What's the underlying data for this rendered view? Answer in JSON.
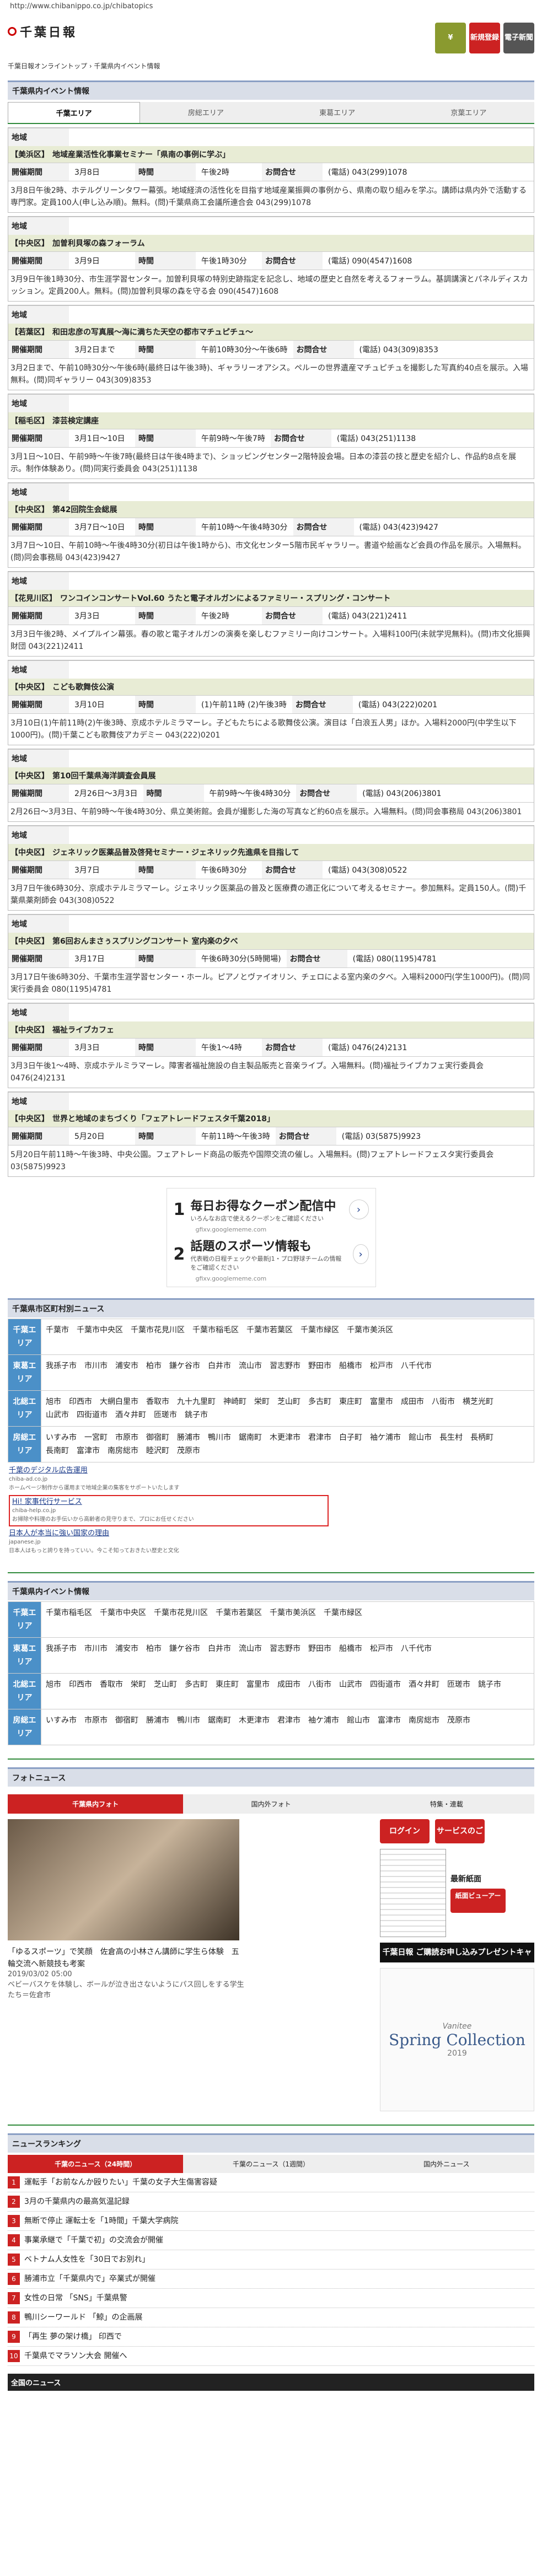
{
  "url": "http://www.chibanippo.co.jp/chibatopics",
  "logo_text": "千葉日報",
  "header_buttons": [
    "新規登録",
    "電子新聞"
  ],
  "breadcrumb": "千葉日報オンライントップ › 千葉県内イベント情報",
  "event_section_title": "千葉県内イベント情報",
  "tabs": [
    "千葉エリア",
    "房総エリア",
    "東葛エリア",
    "京葉エリア"
  ],
  "labels": {
    "period": "開催期間",
    "time": "時間",
    "contact": "お問合せ",
    "area": "地域"
  },
  "events": [
    {
      "area": "【美浜区】",
      "title": "地域産業活性化事業セミナー「県南の事例に学ぶ」",
      "period": "3月8日",
      "time": "午後2時",
      "contact": "(電話) 043(299)1078",
      "desc": "3月8日午後2時、ホテルグリーンタワー幕張。地域経済の活性化を目指す地域産業振興の事例から、県南の取り組みを学ぶ。講師は県内外で活動する専門家。定員100人(申し込み順)。無料。(問)千葉県商工会議所連合会 043(299)1078"
    },
    {
      "area": "【中央区】",
      "title": "加曽利貝塚の森フォーラム",
      "period": "3月9日",
      "time": "午後1時30分",
      "contact": "(電話) 090(4547)1608",
      "desc": "3月9日午後1時30分、市生涯学習センター。加曽利貝塚の特別史跡指定を記念し、地域の歴史と自然を考えるフォーラム。基調講演とパネルディスカッション。定員200人。無料。(問)加曽利貝塚の森を守る会 090(4547)1608"
    },
    {
      "area": "【若葉区】",
      "title": "和田忠彦の写真展〜海に満ちた天空の都市マチュピチュ〜",
      "period": "3月2日まで",
      "time": "午前10時30分〜午後6時",
      "contact": "(電話) 043(309)8353",
      "desc": "3月2日まで、午前10時30分〜午後6時(最終日は午後3時)、ギャラリーオアシス。ペルーの世界遺産マチュピチュを撮影した写真約40点を展示。入場無料。(問)同ギャラリー 043(309)8353"
    },
    {
      "area": "【稲毛区】",
      "title": "漆芸検定講座",
      "period": "3月1日〜10日",
      "time": "午前9時〜午後7時",
      "contact": "(電話) 043(251)1138",
      "desc": "3月1日〜10日、午前9時〜午後7時(最終日は午後4時まで)、ショッピングセンター2階特設会場。日本の漆芸の技と歴史を紹介し、作品約8点を展示。制作体験あり。(問)同実行委員会 043(251)1138"
    },
    {
      "area": "【中央区】",
      "title": "第42回院生会総展",
      "period": "3月7日〜10日",
      "time": "午前10時〜午後4時30分",
      "contact": "(電話) 043(423)9427",
      "desc": "3月7日〜10日、午前10時〜午後4時30分(初日は午後1時から)、市文化センター5階市民ギャラリー。書道や絵画など会員の作品を展示。入場無料。(問)同会事務局 043(423)9427"
    },
    {
      "area": "【花見川区】",
      "title": "ワンコインコンサートVol.60 うたと電子オルガンによるファミリー・スプリング・コンサート",
      "period": "3月3日",
      "time": "午後2時",
      "contact": "(電話) 043(221)2411",
      "desc": "3月3日午後2時、メイプルイン幕張。春の歌と電子オルガンの演奏を楽しむファミリー向けコンサート。入場料100円(未就学児無料)。(問)市文化振興財団 043(221)2411"
    },
    {
      "area": "【中央区】",
      "title": "こども歌舞伎公演",
      "period": "3月10日",
      "time": "(1)午前11時 (2)午後3時",
      "contact": "(電話) 043(222)0201",
      "desc": "3月10日(1)午前11時(2)午後3時、京成ホテルミラマーレ。子どもたちによる歌舞伎公演。演目は「白浪五人男」ほか。入場料2000円(中学生以下1000円)。(問)千葉こども歌舞伎アカデミー 043(222)0201"
    },
    {
      "area": "【中央区】",
      "title": "第10回千葉県海洋調査会員展",
      "period": "2月26日〜3月3日",
      "time": "午前9時〜午後4時30分",
      "contact": "(電話) 043(206)3801",
      "desc": "2月26日〜3月3日、午前9時〜午後4時30分、県立美術館。会員が撮影した海の写真など約60点を展示。入場無料。(問)同会事務局 043(206)3801"
    },
    {
      "area": "【中央区】",
      "title": "ジェネリック医薬品普及啓発セミナー・ジェネリック先進県を目指して",
      "period": "3月7日",
      "time": "午後6時30分",
      "contact": "(電話) 043(308)0522",
      "desc": "3月7日午後6時30分、京成ホテルミラマーレ。ジェネリック医薬品の普及と医療費の適正化について考えるセミナー。参加無料。定員150人。(問)千葉県薬剤師会 043(308)0522"
    },
    {
      "area": "【中央区】",
      "title": "第6回おんまさぅスプリングコンサート 室内楽の夕べ",
      "period": "3月17日",
      "time": "午後6時30分(5時開場)",
      "contact": "(電話) 080(1195)4781",
      "desc": "3月17日午後6時30分、千葉市生涯学習センター・ホール。ピアノとヴァイオリン、チェロによる室内楽の夕べ。入場料2000円(学生1000円)。(問)同実行委員会 080(1195)4781"
    },
    {
      "area": "【中央区】",
      "title": "福祉ライブカフェ",
      "period": "3月3日",
      "time": "午後1〜4時",
      "contact": "(電話) 0476(24)2131",
      "desc": "3月3日午後1〜4時、京成ホテルミラマーレ。障害者福祉施設の自主製品販売と音楽ライブ。入場無料。(問)福祉ライブカフェ実行委員会 0476(24)2131"
    },
    {
      "area": "【中央区】",
      "title": "世界と地域のまちづくり「フェアトレードフェスタ千葉2018」",
      "period": "5月20日",
      "time": "午前11時〜午後3時",
      "contact": "(電話) 03(5875)9923",
      "desc": "5月20日午前11時〜午後3時、中央公園。フェアトレード商品の販売や国際交流の催し。入場無料。(問)フェアトレードフェスタ実行委員会 03(5875)9923"
    }
  ],
  "ads": [
    {
      "num": "1",
      "title": "毎日お得なクーポン配信中",
      "sub": "いろんなお店で使えるクーポンをご確認ください",
      "src": "gfixv.googlememe.com"
    },
    {
      "num": "2",
      "title": "話題のスポーツ情報も",
      "sub": "代表戦の日程チェックや最新J1・プロ野球チームの情報をご確認ください",
      "src": "gfixv.googlememe.com"
    }
  ],
  "cities_section_title": "千葉県市区町村別ニュース",
  "regions_news": [
    {
      "label": "千葉エリア",
      "cities": [
        "千葉市",
        "千葉市中央区",
        "千葉市花見川区",
        "千葉市稲毛区",
        "千葉市若葉区",
        "千葉市緑区",
        "千葉市美浜区"
      ]
    },
    {
      "label": "東葛エリア",
      "cities": [
        "我孫子市",
        "市川市",
        "浦安市",
        "柏市",
        "鎌ケ谷市",
        "白井市",
        "流山市",
        "習志野市",
        "野田市",
        "船橋市",
        "松戸市",
        "八千代市"
      ]
    },
    {
      "label": "北総エリア",
      "cities": [
        "旭市",
        "印西市",
        "大網白里市",
        "香取市",
        "九十九里町",
        "神崎町",
        "栄町",
        "芝山町",
        "多古町",
        "東庄町",
        "富里市",
        "成田市",
        "八街市",
        "横芝光町",
        "山武市",
        "四街道市",
        "酒々井町",
        "匝瑳市",
        "銚子市"
      ]
    },
    {
      "label": "房総エリア",
      "cities": [
        "いすみ市",
        "一宮町",
        "市原市",
        "御宿町",
        "勝浦市",
        "鴨川市",
        "鋸南町",
        "木更津市",
        "君津市",
        "白子町",
        "袖ケ浦市",
        "館山市",
        "長生村",
        "長柄町",
        "長南町",
        "富津市",
        "南房総市",
        "睦沢町",
        "茂原市"
      ]
    }
  ],
  "text_ads": [
    {
      "title": "千葉のデジタル広告運用",
      "url": "chiba-ad.co.jp",
      "desc": "ホームページ制作から運用まで地域企業の集客をサポートいたします"
    },
    {
      "title": "Hi! 家事代行サービス",
      "url": "chiba-help.co.jp",
      "desc": "お掃除や料理のお手伝いから高齢者の見守りまで、プロにお任せください"
    },
    {
      "title": "日本人が本当に強い国家の理由",
      "url": "japanese.jp",
      "desc": "日本人はもっと誇りを持っていい。今こそ知っておきたい歴史と文化"
    }
  ],
  "events_section2_title": "千葉県内イベント情報",
  "regions_events": [
    {
      "label": "千葉エリア",
      "cities": [
        "千葉市稲毛区",
        "千葉市中央区",
        "千葉市花見川区",
        "千葉市若葉区",
        "千葉市美浜区",
        "千葉市緑区"
      ]
    },
    {
      "label": "東葛エリア",
      "cities": [
        "我孫子市",
        "市川市",
        "浦安市",
        "柏市",
        "鎌ケ谷市",
        "白井市",
        "流山市",
        "習志野市",
        "野田市",
        "船橋市",
        "松戸市",
        "八千代市"
      ]
    },
    {
      "label": "北総エリア",
      "cities": [
        "旭市",
        "印西市",
        "香取市",
        "栄町",
        "芝山町",
        "多古町",
        "東庄町",
        "富里市",
        "成田市",
        "八街市",
        "山武市",
        "四街道市",
        "酒々井町",
        "匝瑳市",
        "銚子市"
      ]
    },
    {
      "label": "房総エリア",
      "cities": [
        "いすみ市",
        "市原市",
        "御宿町",
        "勝浦市",
        "鴨川市",
        "鋸南町",
        "木更津市",
        "君津市",
        "袖ケ浦市",
        "館山市",
        "富津市",
        "南房総市",
        "茂原市"
      ]
    }
  ],
  "photo_section_title": "フォトニュース",
  "photo_tabs": [
    "千葉県内フォト",
    "国内外フォト",
    "特集・連載"
  ],
  "photo_caption": "「ゆるスポーツ」で笑顔　佐倉高の小林さん講師に学生ら体験　五輪交流へ新競技も考案",
  "photo_date": "2019/03/02 05:00",
  "photo_sub": "ベビーバスケを体験し、ボールが泣き出さないようにパス回しをする学生たち＝佐倉市",
  "side_buttons": [
    "ログイン",
    "サービスのご案内"
  ],
  "latest_label": "最新紙面",
  "paper_label": "紙面ビューアー",
  "present_banner": "千葉日報 ご購読お申し込みプレゼントキャンペーン実施中",
  "vanity_title": "Spring Collection",
  "vanity_brand": "Vanitee",
  "vanity_year": "2019",
  "ranking_section_title": "ニュースランキング",
  "ranking_tabs": [
    "千葉のニュース（24時間）",
    "千葉のニュース（1週間）",
    "国内外ニュース"
  ],
  "ranking": [
    "運転手「お前なんか殴りたい」千葉の女子大生傷害容疑",
    "3月の千葉県内の最高気温記録",
    "無断で停止 運転士を「1時間」千葉大学病院",
    "事業承継で「千葉で初」の交流会が開催",
    "ベトナム人女性を「30日でお別れ」",
    "勝浦市立「千葉県内で」卒業式が開催",
    "女性の日常 「SNS」千葉県警",
    "鴨川シーワールド 「鯨」の企画展",
    "「再生 夢の架け橋」 印西で",
    "千葉県でマラソン大会 開催へ"
  ],
  "bottom_bar": "全国のニュース"
}
